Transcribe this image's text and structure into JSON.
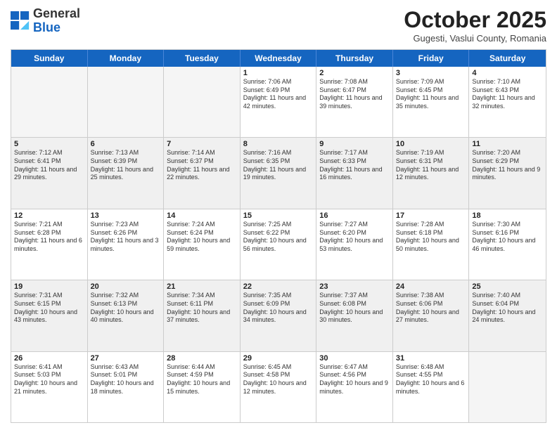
{
  "header": {
    "logo_general": "General",
    "logo_blue": "Blue",
    "month_title": "October 2025",
    "subtitle": "Gugesti, Vaslui County, Romania"
  },
  "days_of_week": [
    "Sunday",
    "Monday",
    "Tuesday",
    "Wednesday",
    "Thursday",
    "Friday",
    "Saturday"
  ],
  "weeks": [
    [
      {
        "day": "",
        "empty": true
      },
      {
        "day": "",
        "empty": true
      },
      {
        "day": "",
        "empty": true
      },
      {
        "day": "1",
        "sunrise": "7:06 AM",
        "sunset": "6:49 PM",
        "daylight": "11 hours and 42 minutes."
      },
      {
        "day": "2",
        "sunrise": "7:08 AM",
        "sunset": "6:47 PM",
        "daylight": "11 hours and 39 minutes."
      },
      {
        "day": "3",
        "sunrise": "7:09 AM",
        "sunset": "6:45 PM",
        "daylight": "11 hours and 35 minutes."
      },
      {
        "day": "4",
        "sunrise": "7:10 AM",
        "sunset": "6:43 PM",
        "daylight": "11 hours and 32 minutes."
      }
    ],
    [
      {
        "day": "5",
        "sunrise": "7:12 AM",
        "sunset": "6:41 PM",
        "daylight": "11 hours and 29 minutes.",
        "shaded": true
      },
      {
        "day": "6",
        "sunrise": "7:13 AM",
        "sunset": "6:39 PM",
        "daylight": "11 hours and 25 minutes.",
        "shaded": true
      },
      {
        "day": "7",
        "sunrise": "7:14 AM",
        "sunset": "6:37 PM",
        "daylight": "11 hours and 22 minutes.",
        "shaded": true
      },
      {
        "day": "8",
        "sunrise": "7:16 AM",
        "sunset": "6:35 PM",
        "daylight": "11 hours and 19 minutes.",
        "shaded": true
      },
      {
        "day": "9",
        "sunrise": "7:17 AM",
        "sunset": "6:33 PM",
        "daylight": "11 hours and 16 minutes.",
        "shaded": true
      },
      {
        "day": "10",
        "sunrise": "7:19 AM",
        "sunset": "6:31 PM",
        "daylight": "11 hours and 12 minutes.",
        "shaded": true
      },
      {
        "day": "11",
        "sunrise": "7:20 AM",
        "sunset": "6:29 PM",
        "daylight": "11 hours and 9 minutes.",
        "shaded": true
      }
    ],
    [
      {
        "day": "12",
        "sunrise": "7:21 AM",
        "sunset": "6:28 PM",
        "daylight": "11 hours and 6 minutes."
      },
      {
        "day": "13",
        "sunrise": "7:23 AM",
        "sunset": "6:26 PM",
        "daylight": "11 hours and 3 minutes."
      },
      {
        "day": "14",
        "sunrise": "7:24 AM",
        "sunset": "6:24 PM",
        "daylight": "10 hours and 59 minutes."
      },
      {
        "day": "15",
        "sunrise": "7:25 AM",
        "sunset": "6:22 PM",
        "daylight": "10 hours and 56 minutes."
      },
      {
        "day": "16",
        "sunrise": "7:27 AM",
        "sunset": "6:20 PM",
        "daylight": "10 hours and 53 minutes."
      },
      {
        "day": "17",
        "sunrise": "7:28 AM",
        "sunset": "6:18 PM",
        "daylight": "10 hours and 50 minutes."
      },
      {
        "day": "18",
        "sunrise": "7:30 AM",
        "sunset": "6:16 PM",
        "daylight": "10 hours and 46 minutes."
      }
    ],
    [
      {
        "day": "19",
        "sunrise": "7:31 AM",
        "sunset": "6:15 PM",
        "daylight": "10 hours and 43 minutes.",
        "shaded": true
      },
      {
        "day": "20",
        "sunrise": "7:32 AM",
        "sunset": "6:13 PM",
        "daylight": "10 hours and 40 minutes.",
        "shaded": true
      },
      {
        "day": "21",
        "sunrise": "7:34 AM",
        "sunset": "6:11 PM",
        "daylight": "10 hours and 37 minutes.",
        "shaded": true
      },
      {
        "day": "22",
        "sunrise": "7:35 AM",
        "sunset": "6:09 PM",
        "daylight": "10 hours and 34 minutes.",
        "shaded": true
      },
      {
        "day": "23",
        "sunrise": "7:37 AM",
        "sunset": "6:08 PM",
        "daylight": "10 hours and 30 minutes.",
        "shaded": true
      },
      {
        "day": "24",
        "sunrise": "7:38 AM",
        "sunset": "6:06 PM",
        "daylight": "10 hours and 27 minutes.",
        "shaded": true
      },
      {
        "day": "25",
        "sunrise": "7:40 AM",
        "sunset": "6:04 PM",
        "daylight": "10 hours and 24 minutes.",
        "shaded": true
      }
    ],
    [
      {
        "day": "26",
        "sunrise": "6:41 AM",
        "sunset": "5:03 PM",
        "daylight": "10 hours and 21 minutes."
      },
      {
        "day": "27",
        "sunrise": "6:43 AM",
        "sunset": "5:01 PM",
        "daylight": "10 hours and 18 minutes."
      },
      {
        "day": "28",
        "sunrise": "6:44 AM",
        "sunset": "4:59 PM",
        "daylight": "10 hours and 15 minutes."
      },
      {
        "day": "29",
        "sunrise": "6:45 AM",
        "sunset": "4:58 PM",
        "daylight": "10 hours and 12 minutes."
      },
      {
        "day": "30",
        "sunrise": "6:47 AM",
        "sunset": "4:56 PM",
        "daylight": "10 hours and 9 minutes."
      },
      {
        "day": "31",
        "sunrise": "6:48 AM",
        "sunset": "4:55 PM",
        "daylight": "10 hours and 6 minutes."
      },
      {
        "day": "",
        "empty": true
      }
    ]
  ]
}
